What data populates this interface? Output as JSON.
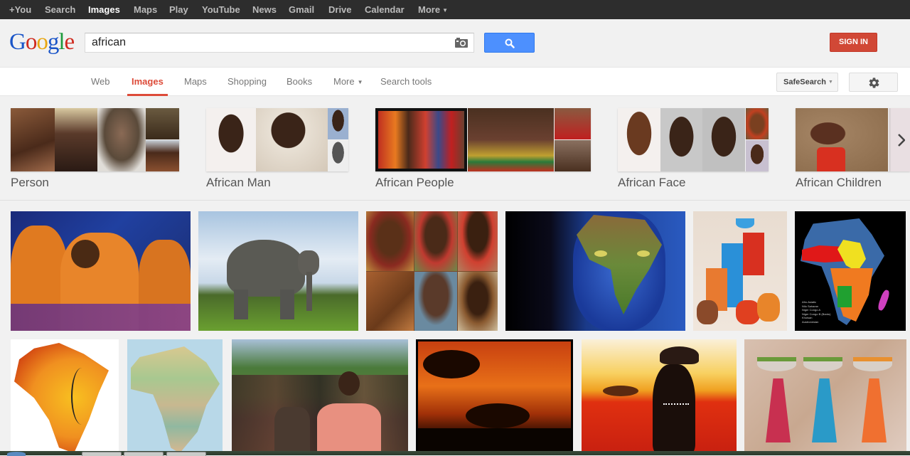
{
  "topbar": {
    "items": [
      {
        "label": "+You",
        "active": false
      },
      {
        "label": "Search",
        "active": false
      },
      {
        "label": "Images",
        "active": true
      },
      {
        "label": "Maps",
        "active": false
      },
      {
        "label": "Play",
        "active": false
      },
      {
        "label": "YouTube",
        "active": false
      },
      {
        "label": "News",
        "active": false
      },
      {
        "label": "Gmail",
        "active": false
      },
      {
        "label": "Drive",
        "active": false
      },
      {
        "label": "Calendar",
        "active": false
      },
      {
        "label": "More",
        "active": false
      }
    ]
  },
  "header": {
    "logo": {
      "l1": "G",
      "l2": "o",
      "l3": "o",
      "l4": "g",
      "l5": "l",
      "l6": "e"
    },
    "search_value": "african",
    "search_icon": "magnifier-icon",
    "camera_icon": "camera-icon",
    "signin_label": "SIGN IN"
  },
  "nav": {
    "tabs": [
      {
        "label": "Web",
        "active": false
      },
      {
        "label": "Images",
        "active": true
      },
      {
        "label": "Maps",
        "active": false
      },
      {
        "label": "Shopping",
        "active": false
      },
      {
        "label": "Books",
        "active": false
      },
      {
        "label": "More",
        "active": false
      },
      {
        "label": "Search tools",
        "active": false
      }
    ],
    "safesearch_label": "SafeSearch",
    "settings_icon": "gear-icon"
  },
  "related_searches": [
    {
      "label": "Person"
    },
    {
      "label": "African Man"
    },
    {
      "label": "African People"
    },
    {
      "label": "African Face"
    },
    {
      "label": "African Children"
    }
  ],
  "results": {
    "row1": [
      {
        "alt": "Children dancing in orange outfits"
      },
      {
        "alt": "African elephant on grassland"
      },
      {
        "alt": "Collage of African faces"
      },
      {
        "alt": "Face painted with map of Africa"
      },
      {
        "alt": "African art painting of women with pots"
      },
      {
        "alt": "Map of African language families"
      }
    ],
    "row2": [
      {
        "alt": "Africa-shaped face illustration"
      },
      {
        "alt": "Political map of Africa"
      },
      {
        "alt": "Crowd of children walking"
      },
      {
        "alt": "Acacia trees at sunset"
      },
      {
        "alt": "Silhouette of woman carrying pot"
      },
      {
        "alt": "Batik of women carrying baskets"
      }
    ]
  },
  "map_legend": [
    "Afro Asiatic",
    "Nilo Saharan",
    "Niger Congo A",
    "Niger Congo B (Bantu)",
    "Khoisan",
    "Austronesian"
  ]
}
